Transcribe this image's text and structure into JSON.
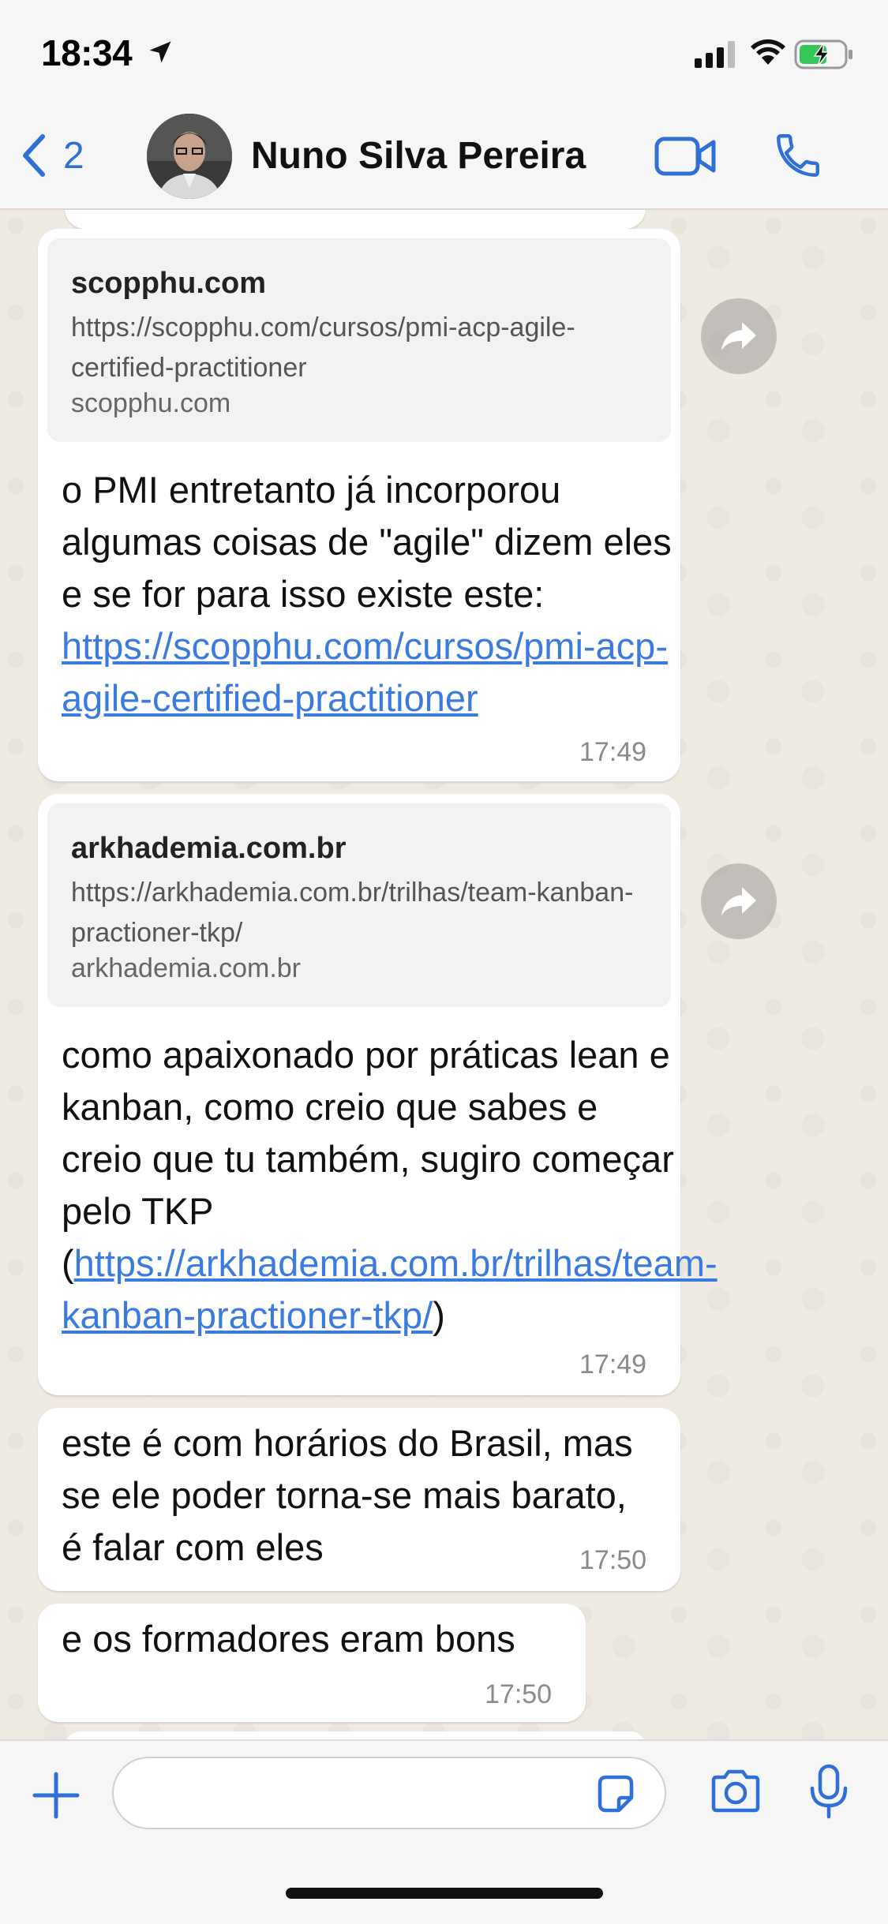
{
  "status_bar": {
    "time": "18:34",
    "icons": [
      "location-arrow-icon",
      "cellular-signal-icon",
      "wifi-icon",
      "battery-charging-icon"
    ]
  },
  "header": {
    "back_count": "2",
    "contact_name": "Nuno Silva Pereira",
    "icons": [
      "chevron-left-icon",
      "video-call-icon",
      "phone-call-icon"
    ]
  },
  "messages": [
    {
      "preview": {
        "title": "scopphu.com",
        "url": "https://scopphu.com/cursos/pmi-acp-agile-certified-practitioner",
        "domain": "scopphu.com"
      },
      "text_before_link": "o PMI entretanto já incorporou algumas coisas de \"agile\" dizem eles e se for para isso existe este: ",
      "link": "https://scopphu.com/cursos/pmi-acp-agile-certified-practitioner",
      "text_after_link": "",
      "time": "17:49"
    },
    {
      "preview": {
        "title": "arkhademia.com.br",
        "url": "https://arkhademia.com.br/trilhas/team-kanban-practioner-tkp/",
        "domain": "arkhademia.com.br"
      },
      "text_before_link": "como apaixonado por práticas lean e kanban, como creio que sabes e creio que tu também, sugiro começar pelo TKP (",
      "link": "https://arkhademia.com.br/trilhas/team-kanban-practioner-tkp/",
      "text_after_link": ")",
      "time": "17:49"
    },
    {
      "text": "este é com horários do Brasil, mas se ele poder torna-se mais barato, é falar com eles",
      "time": "17:50"
    },
    {
      "text": "e os formadores eram bons",
      "time": "17:50"
    }
  ],
  "composer": {
    "input_value": "",
    "icons": [
      "plus-icon",
      "sticker-icon",
      "camera-icon",
      "microphone-icon"
    ]
  },
  "colors": {
    "link": "#3b7be0",
    "ios_blue": "#2f6fd6",
    "chat_bg": "#efeae2",
    "bubble": "#ffffff"
  }
}
